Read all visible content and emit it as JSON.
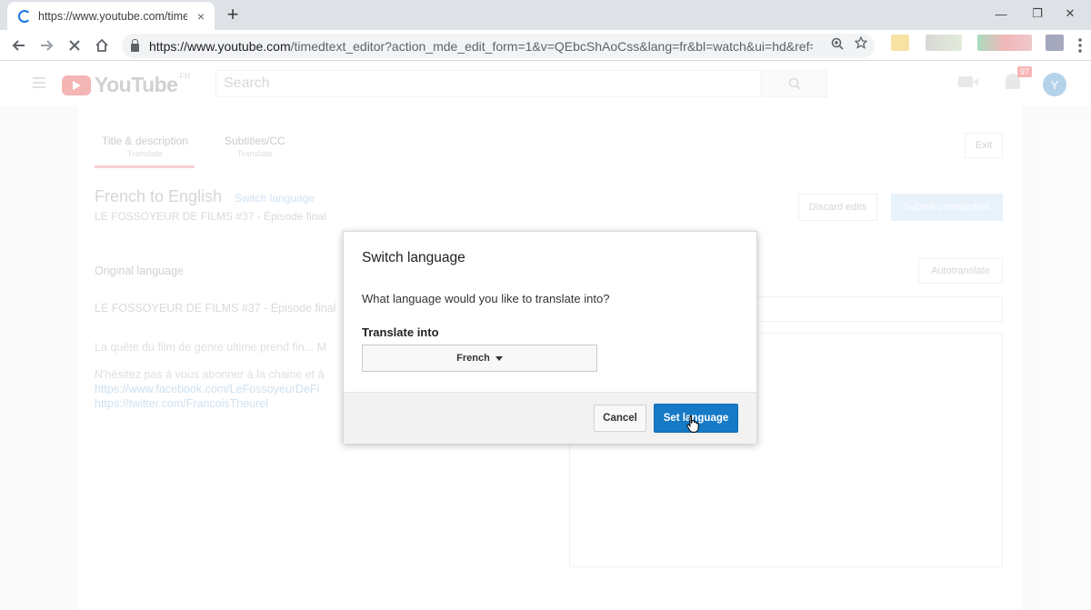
{
  "browser": {
    "tab_title": "https://www.youtube.com/timedtext_editor?",
    "tab_close": "×",
    "new_tab": "+",
    "win_minimize": "—",
    "win_restore": "❐",
    "win_close": "✕",
    "url_host": "https://www.youtube.com",
    "url_path": "/timedtext_editor?action_mde_edit_form=1&v=QEbcShAoCss&lang=fr&bl=watch&ui=hd&ref=wt..."
  },
  "youtube": {
    "logo_text": "YouTube",
    "logo_country": "FR",
    "search_placeholder": "Search",
    "notification_count": "97",
    "avatar_letter": "Y",
    "tabs": [
      {
        "label": "Title & description",
        "sub": "Translate"
      },
      {
        "label": "Subtitles/CC",
        "sub": "Translate"
      }
    ],
    "exit_label": "Exit",
    "page_title": "French to English",
    "switch_language_link": "Switch language",
    "video_title": "LE FOSSOYEUR DE FILMS #37 - Épisode final",
    "discard_label": "Discard edits",
    "submit_label": "Submit contribution",
    "original_language_label": "Original language",
    "autotranslate_label": "Autotranslate",
    "original_title": "LE FOSSOYEUR DE FILMS #37 - Épisode final",
    "description": {
      "line1": "La quête du film de genre ultime prend fin... M",
      "line2": "N'hésitez pas à vous abonner à la chaine et à",
      "line3": "https://www.facebook.com/LeFossoyeurDeFi",
      "line4": "https://twitter.com/FrancoisTheurel"
    }
  },
  "modal": {
    "title": "Switch language",
    "question": "What language would you like to translate into?",
    "translate_label": "Translate into",
    "selected_language": "French",
    "cancel_label": "Cancel",
    "set_label": "Set language"
  }
}
